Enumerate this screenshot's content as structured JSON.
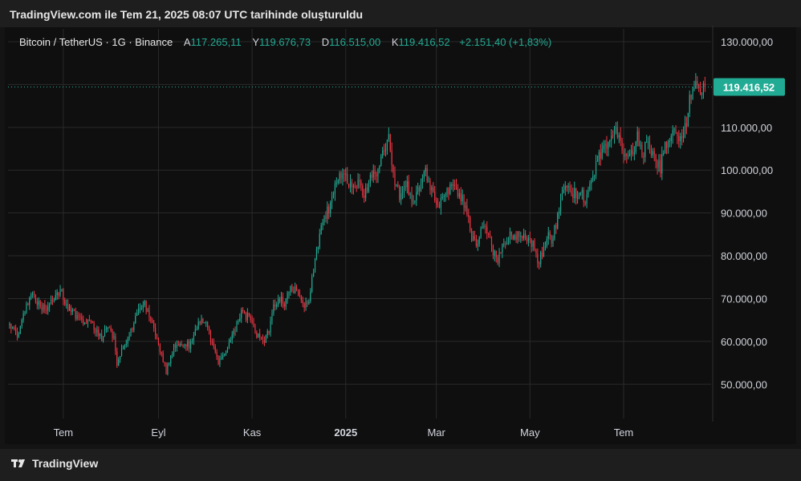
{
  "header": {
    "title": "TradingView.com ile Tem 21, 2025 08:07 UTC tarihinde oluşturuldu"
  },
  "legend": {
    "symbol": "Bitcoin / TetherUS · 1G · Binance",
    "open_label": "A",
    "open": "117.265,11",
    "high_label": "Y",
    "high": "119.676,73",
    "low_label": "D",
    "low": "116.515,00",
    "close_label": "K",
    "close": "119.416,52",
    "change": "+2.151,40 (+1,83%)"
  },
  "footer": {
    "brand": "TradingView"
  },
  "colors": {
    "up": "#22ab94",
    "down": "#f23645",
    "price_tag": "#22ab94",
    "background": "#0f0f0f",
    "grid": "#2a2a2a"
  },
  "chart_data": {
    "type": "candlestick",
    "title": "Bitcoin / TetherUS · 1G · Binance",
    "interval": "1G",
    "grid": true,
    "y_axis_position": "right",
    "ylim": [
      42000,
      133000
    ],
    "y_ticks": [
      50000,
      60000,
      70000,
      80000,
      90000,
      100000,
      110000,
      120000,
      130000
    ],
    "y_tick_labels": [
      "50.000,00",
      "60.000,00",
      "70.000,00",
      "80.000,00",
      "90.000,00",
      "100.000,00",
      "110.000,00",
      "120.000,00",
      "130.000,00"
    ],
    "x_ticks": [
      {
        "label": "Tem",
        "date": "2024-07-01",
        "bold": false
      },
      {
        "label": "Eyl",
        "date": "2024-09-01",
        "bold": false
      },
      {
        "label": "Kas",
        "date": "2024-11-01",
        "bold": false
      },
      {
        "label": "2025",
        "date": "2025-01-01",
        "bold": true
      },
      {
        "label": "Mar",
        "date": "2025-03-01",
        "bold": false
      },
      {
        "label": "May",
        "date": "2025-05-01",
        "bold": false
      },
      {
        "label": "Tem",
        "date": "2025-07-01",
        "bold": false
      }
    ],
    "last_price": 119416.52,
    "last_price_label": "119.416,52",
    "close_path": [
      [
        "2024-05-27",
        64500
      ],
      [
        "2024-06-01",
        61200
      ],
      [
        "2024-06-06",
        66800
      ],
      [
        "2024-06-10",
        71200
      ],
      [
        "2024-06-15",
        68500
      ],
      [
        "2024-06-20",
        67200
      ],
      [
        "2024-06-25",
        70300
      ],
      [
        "2024-06-30",
        71300
      ],
      [
        "2024-07-04",
        68000
      ],
      [
        "2024-07-08",
        66500
      ],
      [
        "2024-07-13",
        64500
      ],
      [
        "2024-07-18",
        65000
      ],
      [
        "2024-07-22",
        62500
      ],
      [
        "2024-07-26",
        61000
      ],
      [
        "2024-07-30",
        63000
      ],
      [
        "2024-08-03",
        60500
      ],
      [
        "2024-08-05",
        54500
      ],
      [
        "2024-08-09",
        58500
      ],
      [
        "2024-08-13",
        61000
      ],
      [
        "2024-08-18",
        67500
      ],
      [
        "2024-08-23",
        68500
      ],
      [
        "2024-08-27",
        65500
      ],
      [
        "2024-09-01",
        59500
      ],
      [
        "2024-09-06",
        53000
      ],
      [
        "2024-09-11",
        58500
      ],
      [
        "2024-09-16",
        60000
      ],
      [
        "2024-09-21",
        59000
      ],
      [
        "2024-09-26",
        63500
      ],
      [
        "2024-10-01",
        65000
      ],
      [
        "2024-10-05",
        60500
      ],
      [
        "2024-10-10",
        55000
      ],
      [
        "2024-10-15",
        57500
      ],
      [
        "2024-10-20",
        62000
      ],
      [
        "2024-10-25",
        66500
      ],
      [
        "2024-10-30",
        65500
      ],
      [
        "2024-11-04",
        61500
      ],
      [
        "2024-11-08",
        59500
      ],
      [
        "2024-11-12",
        62500
      ],
      [
        "2024-11-14",
        67000
      ],
      [
        "2024-11-18",
        70500
      ],
      [
        "2024-11-22",
        69000
      ],
      [
        "2024-11-26",
        73000
      ],
      [
        "2024-11-30",
        72000
      ],
      [
        "2024-12-04",
        69000
      ],
      [
        "2024-12-08",
        68500
      ],
      [
        "2024-12-10",
        75000
      ],
      [
        "2024-12-13",
        81000
      ],
      [
        "2024-12-17",
        87500
      ],
      [
        "2024-12-21",
        91000
      ],
      [
        "2024-12-25",
        96000
      ],
      [
        "2024-12-29",
        99000
      ],
      [
        "2025-01-02",
        97500
      ],
      [
        "2025-01-06",
        95000
      ],
      [
        "2025-01-10",
        97500
      ],
      [
        "2025-01-13",
        94000
      ],
      [
        "2025-01-17",
        98500
      ],
      [
        "2025-01-21",
        100000
      ],
      [
        "2025-01-25",
        104500
      ],
      [
        "2025-01-29",
        107500
      ],
      [
        "2025-02-02",
        96500
      ],
      [
        "2025-02-06",
        93500
      ],
      [
        "2025-02-10",
        96500
      ],
      [
        "2025-02-14",
        92000
      ],
      [
        "2025-02-18",
        96000
      ],
      [
        "2025-02-22",
        99000
      ],
      [
        "2025-02-26",
        95500
      ],
      [
        "2025-03-02",
        91500
      ],
      [
        "2025-03-06",
        93500
      ],
      [
        "2025-03-10",
        95500
      ],
      [
        "2025-03-13",
        96000
      ],
      [
        "2025-03-17",
        94000
      ],
      [
        "2025-03-20",
        91000
      ],
      [
        "2025-03-24",
        84500
      ],
      [
        "2025-03-28",
        82500
      ],
      [
        "2025-04-01",
        88000
      ],
      [
        "2025-04-04",
        84500
      ],
      [
        "2025-04-07",
        81000
      ],
      [
        "2025-04-10",
        79000
      ],
      [
        "2025-04-14",
        83500
      ],
      [
        "2025-04-18",
        84500
      ],
      [
        "2025-04-22",
        85000
      ],
      [
        "2025-04-26",
        84500
      ],
      [
        "2025-04-30",
        84000
      ],
      [
        "2025-05-03",
        82500
      ],
      [
        "2025-05-06",
        78500
      ],
      [
        "2025-05-09",
        80500
      ],
      [
        "2025-05-12",
        84500
      ],
      [
        "2025-05-15",
        84000
      ],
      [
        "2025-05-18",
        87500
      ],
      [
        "2025-05-21",
        92500
      ],
      [
        "2025-05-25",
        96000
      ],
      [
        "2025-05-29",
        94500
      ],
      [
        "2025-06-02",
        95000
      ],
      [
        "2025-06-06",
        93500
      ],
      [
        "2025-06-10",
        97000
      ],
      [
        "2025-06-14",
        102500
      ],
      [
        "2025-06-18",
        104500
      ],
      [
        "2025-06-22",
        106000
      ],
      [
        "2025-06-26",
        109000
      ],
      [
        "2025-06-30",
        105000
      ],
      [
        "2025-07-03",
        102500
      ],
      [
        "2025-07-07",
        104500
      ],
      [
        "2025-07-10",
        107500
      ],
      [
        "2025-07-13",
        103500
      ],
      [
        "2025-07-16",
        106000
      ],
      [
        "2025-07-19",
        104000
      ],
      [
        "2025-07-22",
        102000
      ],
      [
        "2025-07-25",
        100500
      ],
      [
        "2025-07-28",
        106000
      ],
      [
        "2025-07-31",
        108000
      ],
      [
        "2025-08-03",
        109500
      ],
      [
        "2025-08-06",
        107500
      ],
      [
        "2025-08-08",
        108500
      ],
      [
        "2025-08-11",
        111500
      ],
      [
        "2025-08-13",
        117000
      ],
      [
        "2025-08-15",
        118500
      ],
      [
        "2025-08-17",
        119500
      ],
      [
        "2025-08-19",
        117500
      ],
      [
        "2025-08-21",
        118500
      ],
      [
        "2025-08-23",
        119416.52
      ]
    ]
  }
}
